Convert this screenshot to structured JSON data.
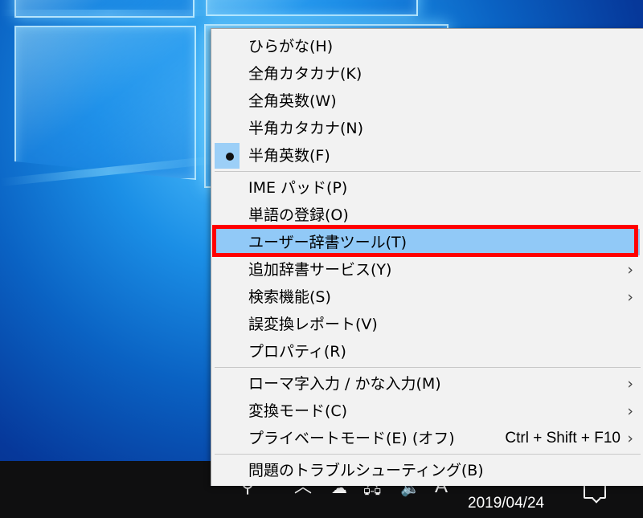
{
  "context_menu": {
    "items": [
      {
        "label": "ひらがな(H)"
      },
      {
        "label": "全角カタカナ(K)"
      },
      {
        "label": "全角英数(W)"
      },
      {
        "label": "半角カタカナ(N)"
      },
      {
        "label": "半角英数(F)",
        "selected": true
      },
      {
        "label": "IME パッド(P)"
      },
      {
        "label": "単語の登録(O)"
      },
      {
        "label": "ユーザー辞書ツール(T)",
        "highlighted": true
      },
      {
        "label": "追加辞書サービス(Y)",
        "submenu": true
      },
      {
        "label": "検索機能(S)",
        "submenu": true
      },
      {
        "label": "誤変換レポート(V)"
      },
      {
        "label": "プロパティ(R)"
      },
      {
        "label": "ローマ字入力 / かな入力(M)",
        "submenu": true
      },
      {
        "label": "変換モード(C)",
        "submenu": true
      },
      {
        "label": "プライベートモード(E) (オフ)",
        "shortcut": "Ctrl + Shift + F10",
        "submenu": true
      },
      {
        "label": "問題のトラブルシューティング(B)"
      }
    ],
    "bullet_glyph": "●",
    "submenu_glyph": "›",
    "highlight_color": "#91c9f7",
    "annotation_color": "#ff0000"
  },
  "taskbar": {
    "ime_mode": "A",
    "date": "2019/04/24",
    "icons": [
      "people-icon",
      "chevron-up-icon",
      "onedrive-icon",
      "network-icon",
      "volume-icon",
      "notification-icon"
    ]
  },
  "icons": {
    "people": "⚲",
    "chevron_up": "︿",
    "onedrive": "☁",
    "network": "🖧",
    "volume": "🔈"
  }
}
